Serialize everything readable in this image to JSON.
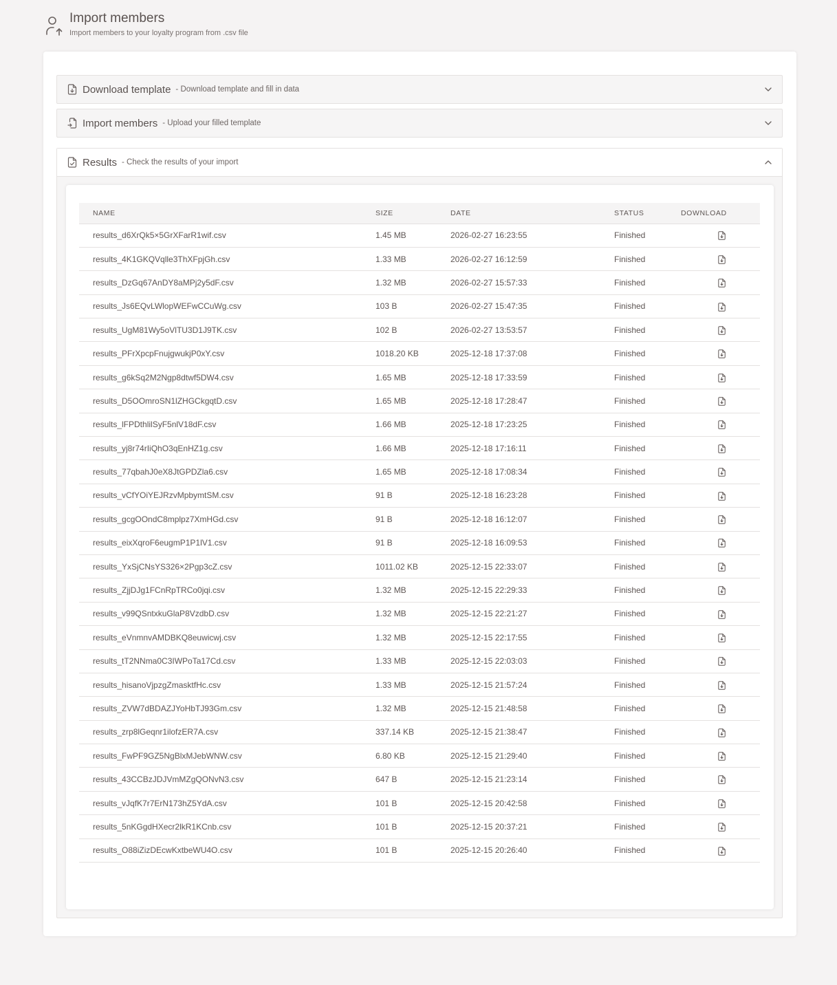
{
  "header": {
    "title": "Import members",
    "subtitle": "Import members to your loyalty program from .csv file",
    "icon": "user-upload-icon"
  },
  "sections": [
    {
      "title": "Download template",
      "desc": "- Download template and fill in data",
      "icon": "file-download-icon",
      "expanded": false
    },
    {
      "title": "Import members",
      "desc": "- Upload your filled template",
      "icon": "file-import-icon",
      "expanded": false
    },
    {
      "title": "Results",
      "desc": "- Check the results of your import",
      "icon": "file-check-icon",
      "expanded": true
    }
  ],
  "table": {
    "columns": [
      "NAME",
      "SIZE",
      "DATE",
      "STATUS",
      "DOWNLOAD"
    ],
    "rows": [
      {
        "name": "results_d6XrQk5×5GrXFarR1wif.csv",
        "size": "1.45 MB",
        "date": "2026-02-27 16:23:55",
        "status": "Finished"
      },
      {
        "name": "results_4K1GKQVqlle3ThXFpjGh.csv",
        "size": "1.33 MB",
        "date": "2026-02-27 16:12:59",
        "status": "Finished"
      },
      {
        "name": "results_DzGq67AnDY8aMPj2y5dF.csv",
        "size": "1.32 MB",
        "date": "2026-02-27 15:57:33",
        "status": "Finished"
      },
      {
        "name": "results_Js6EQvLWlopWEFwCCuWg.csv",
        "size": "103 B",
        "date": "2026-02-27 15:47:35",
        "status": "Finished"
      },
      {
        "name": "results_UgM81Wy5oVlTU3D1J9TK.csv",
        "size": "102 B",
        "date": "2026-02-27 13:53:57",
        "status": "Finished"
      },
      {
        "name": "results_PFrXpcpFnujgwukjP0xY.csv",
        "size": "1018.20 KB",
        "date": "2025-12-18 17:37:08",
        "status": "Finished"
      },
      {
        "name": "results_g6kSq2M2Ngp8dtwf5DW4.csv",
        "size": "1.65 MB",
        "date": "2025-12-18 17:33:59",
        "status": "Finished"
      },
      {
        "name": "results_D5OOmroSN1lZHGCkgqtD.csv",
        "size": "1.65 MB",
        "date": "2025-12-18 17:28:47",
        "status": "Finished"
      },
      {
        "name": "results_lFPDthlilSyF5nlV18dF.csv",
        "size": "1.66 MB",
        "date": "2025-12-18 17:23:25",
        "status": "Finished"
      },
      {
        "name": "results_yj8r74rIiQhO3qEnHZ1g.csv",
        "size": "1.66 MB",
        "date": "2025-12-18 17:16:11",
        "status": "Finished"
      },
      {
        "name": "results_77qbahJ0eX8JtGPDZla6.csv",
        "size": "1.65 MB",
        "date": "2025-12-18 17:08:34",
        "status": "Finished"
      },
      {
        "name": "results_vCfYOiYEJRzvMpbymtSM.csv",
        "size": "91 B",
        "date": "2025-12-18 16:23:28",
        "status": "Finished"
      },
      {
        "name": "results_gcgOOndC8mplpz7XmHGd.csv",
        "size": "91 B",
        "date": "2025-12-18 16:12:07",
        "status": "Finished"
      },
      {
        "name": "results_eixXqroF6eugmP1P1lV1.csv",
        "size": "91 B",
        "date": "2025-12-18 16:09:53",
        "status": "Finished"
      },
      {
        "name": "results_YxSjCNsYS326×2Pgp3cZ.csv",
        "size": "1011.02 KB",
        "date": "2025-12-15 22:33:07",
        "status": "Finished"
      },
      {
        "name": "results_ZjjDJg1FCnRpTRCo0jqi.csv",
        "size": "1.32 MB",
        "date": "2025-12-15 22:29:33",
        "status": "Finished"
      },
      {
        "name": "results_v99QSntxkuGlaP8VzdbD.csv",
        "size": "1.32 MB",
        "date": "2025-12-15 22:21:27",
        "status": "Finished"
      },
      {
        "name": "results_eVnmnvAMDBKQ8euwicwj.csv",
        "size": "1.32 MB",
        "date": "2025-12-15 22:17:55",
        "status": "Finished"
      },
      {
        "name": "results_tT2NNma0C3IWPoTa17Cd.csv",
        "size": "1.33 MB",
        "date": "2025-12-15 22:03:03",
        "status": "Finished"
      },
      {
        "name": "results_hisanoVjpzgZmasktfHc.csv",
        "size": "1.33 MB",
        "date": "2025-12-15 21:57:24",
        "status": "Finished"
      },
      {
        "name": "results_ZVW7dBDAZJYoHbTJ93Gm.csv",
        "size": "1.32 MB",
        "date": "2025-12-15 21:48:58",
        "status": "Finished"
      },
      {
        "name": "results_zrp8lGeqnr1ilofzER7A.csv",
        "size": "337.14 KB",
        "date": "2025-12-15 21:38:47",
        "status": "Finished"
      },
      {
        "name": "results_FwPF9GZ5NgBlxMJebWNW.csv",
        "size": "6.80 KB",
        "date": "2025-12-15 21:29:40",
        "status": "Finished"
      },
      {
        "name": "results_43CCBzJDJVmMZgQONvN3.csv",
        "size": "647 B",
        "date": "2025-12-15 21:23:14",
        "status": "Finished"
      },
      {
        "name": "results_vJqfK7r7ErN173hZ5YdA.csv",
        "size": "101 B",
        "date": "2025-12-15 20:42:58",
        "status": "Finished"
      },
      {
        "name": "results_5nKGgdHXecr2lkR1KCnb.csv",
        "size": "101 B",
        "date": "2025-12-15 20:37:21",
        "status": "Finished"
      },
      {
        "name": "results_O88iZizDEcwKxtbeWU4O.csv",
        "size": "101 B",
        "date": "2025-12-15 20:26:40",
        "status": "Finished"
      }
    ],
    "download_icon": "file-download-icon"
  },
  "colors": {
    "background": "#f5f3f3",
    "text": "#5b5351",
    "border": "#e4e1e0",
    "header_row": "#f5f4f4"
  }
}
